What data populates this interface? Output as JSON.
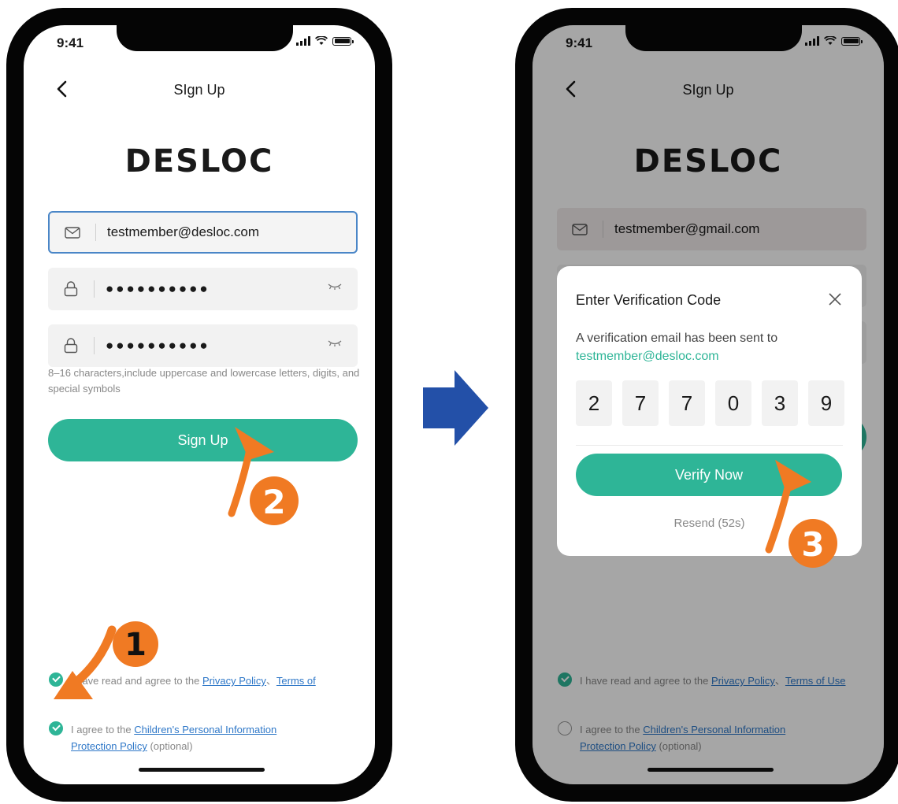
{
  "left": {
    "status": {
      "time": "9:41"
    },
    "header": {
      "title": "SIgn Up"
    },
    "logo": "DESLOC",
    "email": {
      "value": "testmember@desloc.com"
    },
    "password": {
      "mask": "●●●●●●●●●●"
    },
    "confirm": {
      "mask": "●●●●●●●●●●"
    },
    "hint": "8–16 characters,include uppercase and lowercase letters, digits, and special symbols",
    "signup_button": "Sign Up",
    "agree_privacy": {
      "prefix": "I have read and agree to the ",
      "link1": "Privacy Policy",
      "sep": "、",
      "link2": "Terms of",
      "checked": true
    },
    "agree_children": {
      "prefix": "I agree to the ",
      "link1": "Children's Personal Information",
      "link2": "Protection Policy",
      "suffix": " (optional)",
      "checked": true
    }
  },
  "right": {
    "status": {
      "time": "9:41"
    },
    "header": {
      "title": "SIgn Up"
    },
    "logo": "DESLOC",
    "email": {
      "value": "testmember@gmail.com"
    },
    "modal": {
      "title": "Enter Verification Code",
      "message": "A verification email has been sent to",
      "email": "testmember@desloc.com",
      "code": [
        "2",
        "7",
        "7",
        "0",
        "3",
        "9"
      ],
      "verify_button": "Verify Now",
      "resend": "Resend (52s)"
    },
    "agree_privacy": {
      "prefix": "I have read and agree to the ",
      "link1": "Privacy Policy",
      "sep": "、",
      "link2": "Terms of Use",
      "checked": true
    },
    "agree_children": {
      "prefix": "I agree to the ",
      "link1": "Children's Personal Information",
      "link2": "Protection Policy",
      "suffix": " (optional)",
      "checked": false
    }
  },
  "annotations": {
    "steps": [
      "1",
      "2",
      "3"
    ],
    "flow_arrow_color": "#2350a8",
    "step_color": "#f07a23"
  },
  "colors": {
    "accent": "#2eb597",
    "link": "#2f78c8"
  }
}
